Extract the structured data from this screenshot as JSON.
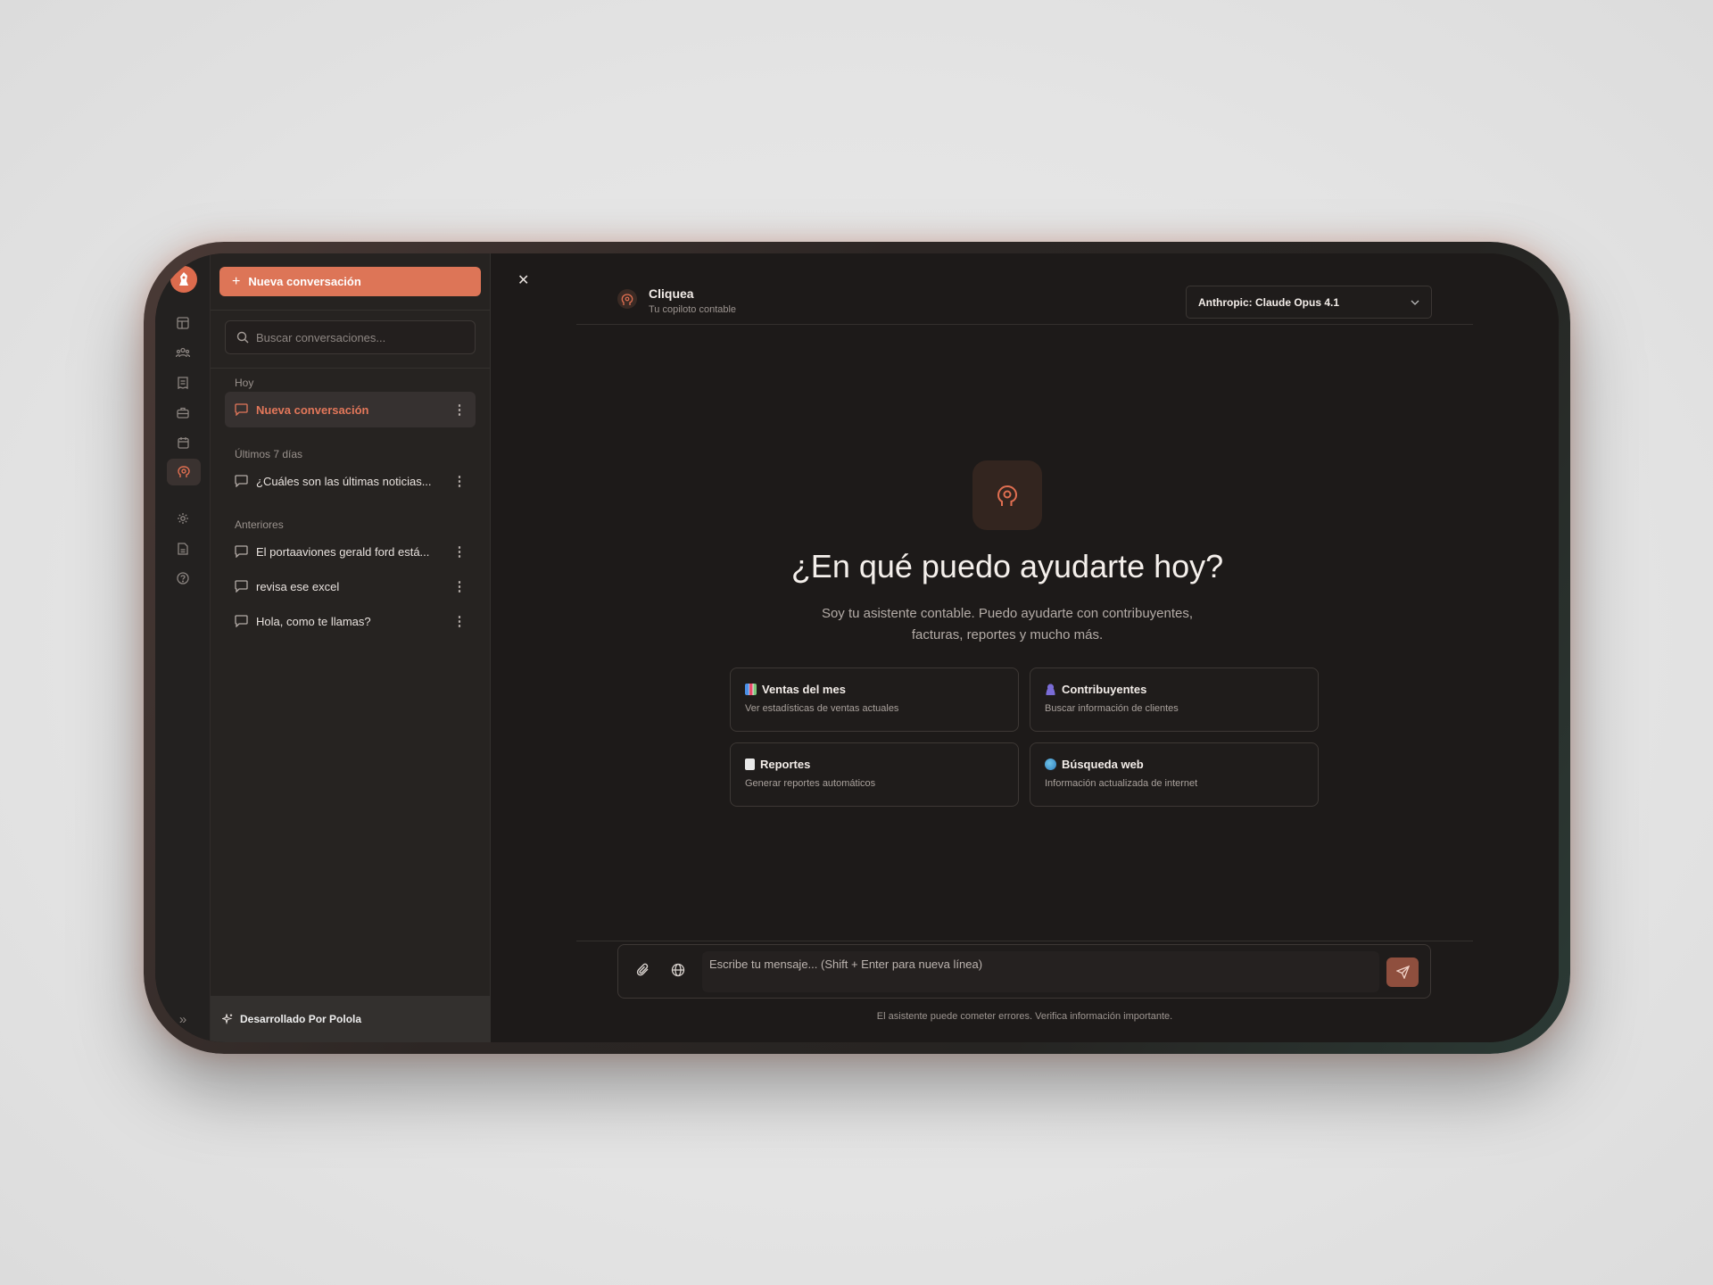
{
  "sidebar": {
    "new_conversation_label": "Nueva conversación",
    "search_placeholder": "Buscar conversaciones...",
    "groups": [
      {
        "label": "Hoy",
        "items": [
          {
            "title": "Nueva conversación"
          }
        ]
      },
      {
        "label": "Últimos 7 días",
        "items": [
          {
            "title": "¿Cuáles son las últimas noticias..."
          }
        ]
      },
      {
        "label": "Anteriores",
        "items": [
          {
            "title": "El portaaviones gerald ford está..."
          },
          {
            "title": "revisa ese excel"
          },
          {
            "title": "Hola, como te llamas?"
          }
        ]
      }
    ],
    "footer": "Desarrollado Por Polola",
    "rail_icons": [
      "dashboard-icon",
      "users-icon",
      "receipt-icon",
      "briefcase-icon",
      "calendar-icon",
      "assistant-icon",
      "settings-icon",
      "file-icon",
      "help-icon"
    ]
  },
  "header": {
    "app_name": "Cliquea",
    "app_subtitle": "Tu copiloto contable",
    "model": "Anthropic: Claude Opus 4.1"
  },
  "hero": {
    "title": "¿En qué puedo ayudarte hoy?",
    "subtitle_line1": "Soy tu asistente contable. Puedo ayudarte con contribuyentes,",
    "subtitle_line2": "facturas, reportes y mucho más."
  },
  "suggestions": [
    {
      "title": "Ventas del mes",
      "desc": "Ver estadísticas de ventas actuales",
      "icon": "chart-emoji"
    },
    {
      "title": "Contribuyentes",
      "desc": "Buscar información de clientes",
      "icon": "person-emoji"
    },
    {
      "title": "Reportes",
      "desc": "Generar reportes automáticos",
      "icon": "document-emoji"
    },
    {
      "title": "Búsqueda web",
      "desc": "Información actualizada de internet",
      "icon": "globe-emoji"
    }
  ],
  "composer": {
    "placeholder": "Escribe tu mensaje... (Shift + Enter para nueva línea)"
  },
  "disclaimer": "El asistente puede cometer errores. Verifica información importante.",
  "colors": {
    "accent": "#dd7557",
    "background": "#1d1a19",
    "panel": "#262321"
  }
}
